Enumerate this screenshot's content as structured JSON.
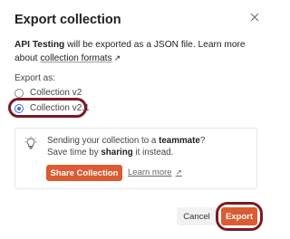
{
  "dialog": {
    "title": "Export collection",
    "description": {
      "collection_name": "API Testing",
      "text": " will be exported as a JSON file. Learn more about ",
      "link": "collection formats",
      "link_icon": "external-link-icon"
    },
    "export_as_label": "Export as:",
    "options": [
      {
        "label": "Collection v2",
        "selected": false
      },
      {
        "label": "Collection v2.1",
        "selected": true
      }
    ],
    "tip": {
      "line1_prefix": "Sending your collection to a ",
      "line1_bold": "teammate",
      "line1_suffix": "?",
      "line2_prefix": "Save time by ",
      "line2_bold": "sharing",
      "line2_suffix": " it instead.",
      "share_button": "Share Collection",
      "learn_more": "Learn more",
      "icon": "lightbulb-icon"
    },
    "buttons": {
      "cancel": "Cancel",
      "export": "Export"
    },
    "colors": {
      "accent": "#dc5b32",
      "radio_selected": "#3b6de1",
      "highlight": "#7a1a25"
    }
  }
}
